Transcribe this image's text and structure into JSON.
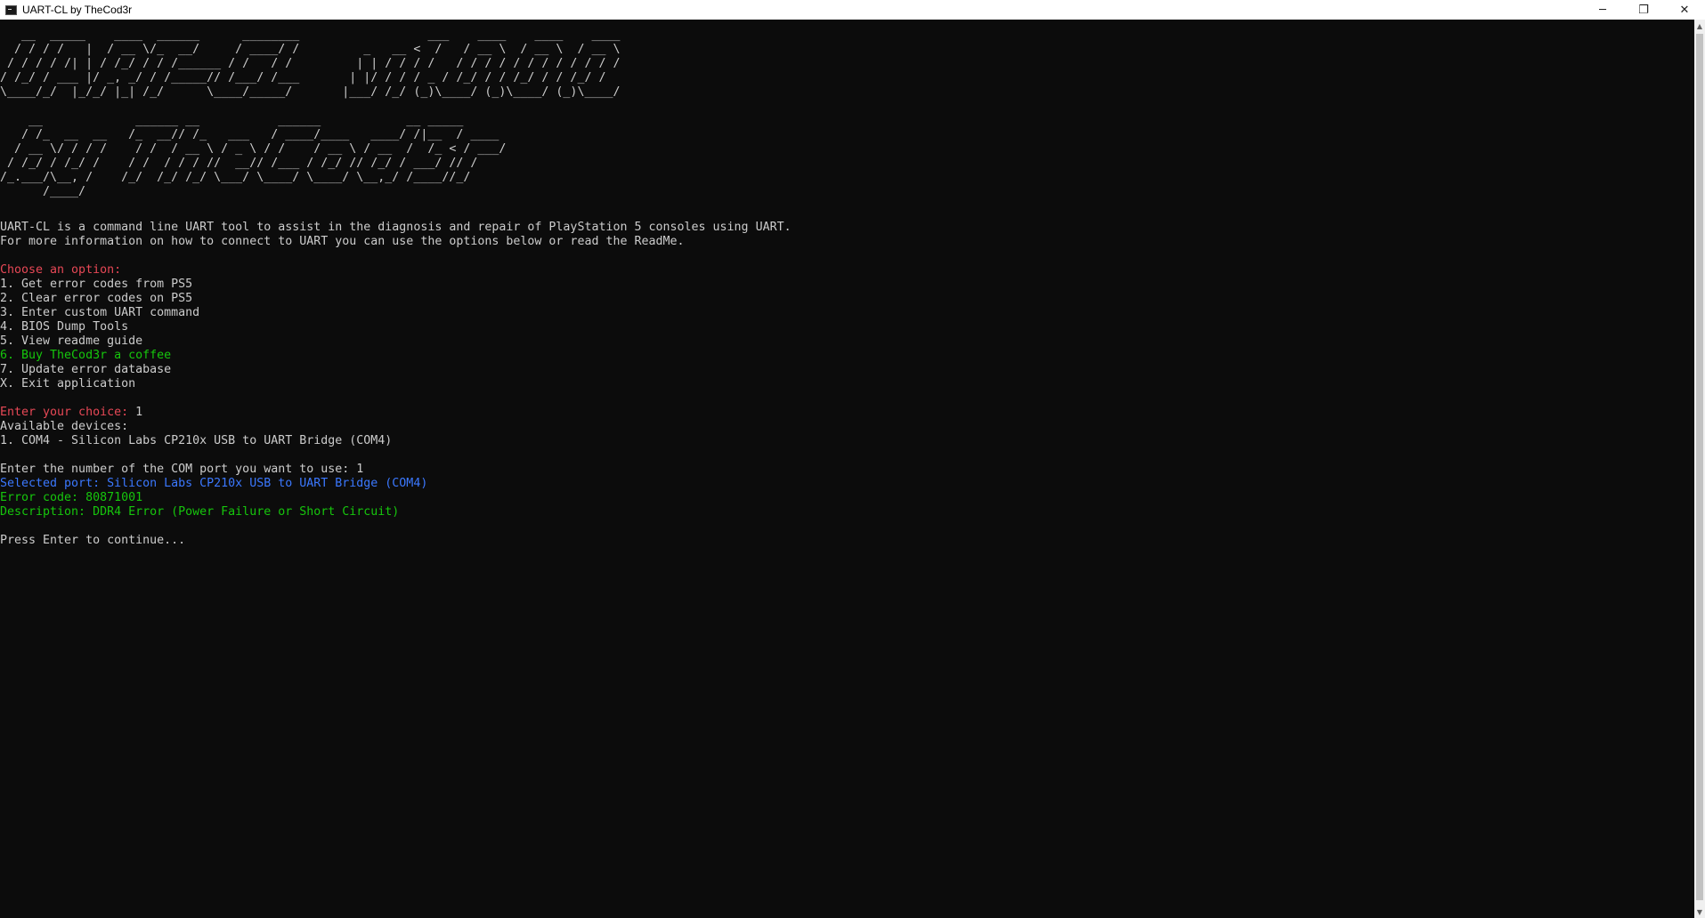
{
  "window": {
    "title": "UART-CL by TheCod3r",
    "minimize_icon": "─",
    "restore_icon": "❐",
    "close_icon": "✕"
  },
  "banner": {
    "line1": "   __  _____    ____  ______      ________                  ___    ____    ____    ____ ",
    "line2": "  / / / /   |  / __ \\/_  __/     / ____/ /         _   __ <  /   / __ \\  / __ \\  / __ \\",
    "line3": " / / / / /| | / /_/ / / /______ / /   / /         | | / / / /   / / / / / / / / / / / /",
    "line4": "/ /_/ / ___ |/ _, _/ / /_____// /___/ /___       | |/ / / / _ / /_/ / / /_/ / / /_/ / ",
    "line5": "\\____/_/  |_/_/ |_| /_/      \\____/_____/       |___/ /_/ (_)\\____/ (_)\\____/ (_)\\____/  "
  },
  "byline": {
    "line1": "    __             ______ __           ______            __ _____     ",
    "line2": "   / /_  __  __   /_  __// /_   ___   / ____/____   ____/ /|__  / ____",
    "line3": "  / __ \\/ / / /    / /  / __ \\ / _ \\ / /    / __ \\ / __  /  /_ < / ___/",
    "line4": " / /_/ / /_/ /    / /  / / / //  __// /___ / /_/ // /_/ / ___/ // /    ",
    "line5": "/_.___/\\__, /    /_/  /_/ /_/ \\___/ \\____/ \\____/ \\__,_/ /____//_/     ",
    "line6": "      /____/                                                          "
  },
  "intro": {
    "line1": "UART-CL is a command line UART tool to assist in the diagnosis and repair of PlayStation 5 consoles using UART.",
    "line2": "For more information on how to connect to UART you can use the options below or read the ReadMe."
  },
  "menu": {
    "heading": "Choose an option:",
    "items": [
      "1. Get error codes from PS5",
      "2. Clear error codes on PS5",
      "3. Enter custom UART command",
      "4. BIOS Dump Tools",
      "5. View readme guide",
      "6. Buy TheCod3r a coffee",
      "7. Update error database",
      "X. Exit application"
    ]
  },
  "session": {
    "choice_prompt": "Enter your choice: ",
    "choice_value": "1",
    "devices_heading": "Available devices:",
    "device_1": "1. COM4 - Silicon Labs CP210x USB to UART Bridge (COM4)",
    "port_prompt": "Enter the number of the COM port you want to use: ",
    "port_value": "1",
    "selected_port": "Selected port: Silicon Labs CP210x USB to UART Bridge (COM4)",
    "error_code": "Error code: 80871001",
    "description": "Description: DDR4 Error (Power Failure or Short Circuit)",
    "continue_prompt": "Press Enter to continue..."
  },
  "colors": {
    "background": "#0c0c0c",
    "text": "#cccccc",
    "red": "#e74856",
    "green": "#16c60c",
    "blue": "#3b78ff"
  }
}
